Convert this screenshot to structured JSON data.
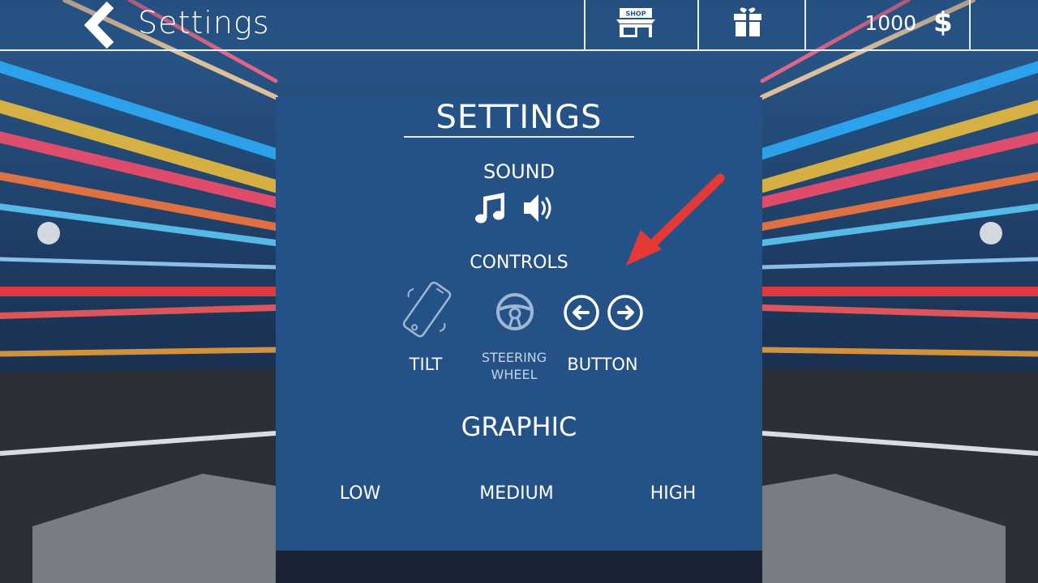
{
  "header": {
    "title": "Settings",
    "shop_sign": "SHOP",
    "coins": "1000",
    "currency_symbol": "$"
  },
  "panel": {
    "title": "SETTINGS",
    "sound": {
      "label": "SOUND",
      "icons": [
        "music-icon",
        "speaker-icon"
      ]
    },
    "controls": {
      "label": "CONTROLS",
      "options": [
        {
          "label": "TILT",
          "icon": "tilt-phone-icon"
        },
        {
          "label_line1": "STEERING",
          "label_line2": "WHEEL",
          "icon": "steering-wheel-icon"
        },
        {
          "label": "BUTTON",
          "icon": "arrow-buttons-icon"
        }
      ]
    },
    "graphic": {
      "label": "GRAPHIC",
      "options": [
        "LOW",
        "MEDIUM",
        "HIGH"
      ]
    }
  },
  "colors": {
    "panel_bg": "#255286",
    "annotation_arrow": "#e53935"
  }
}
